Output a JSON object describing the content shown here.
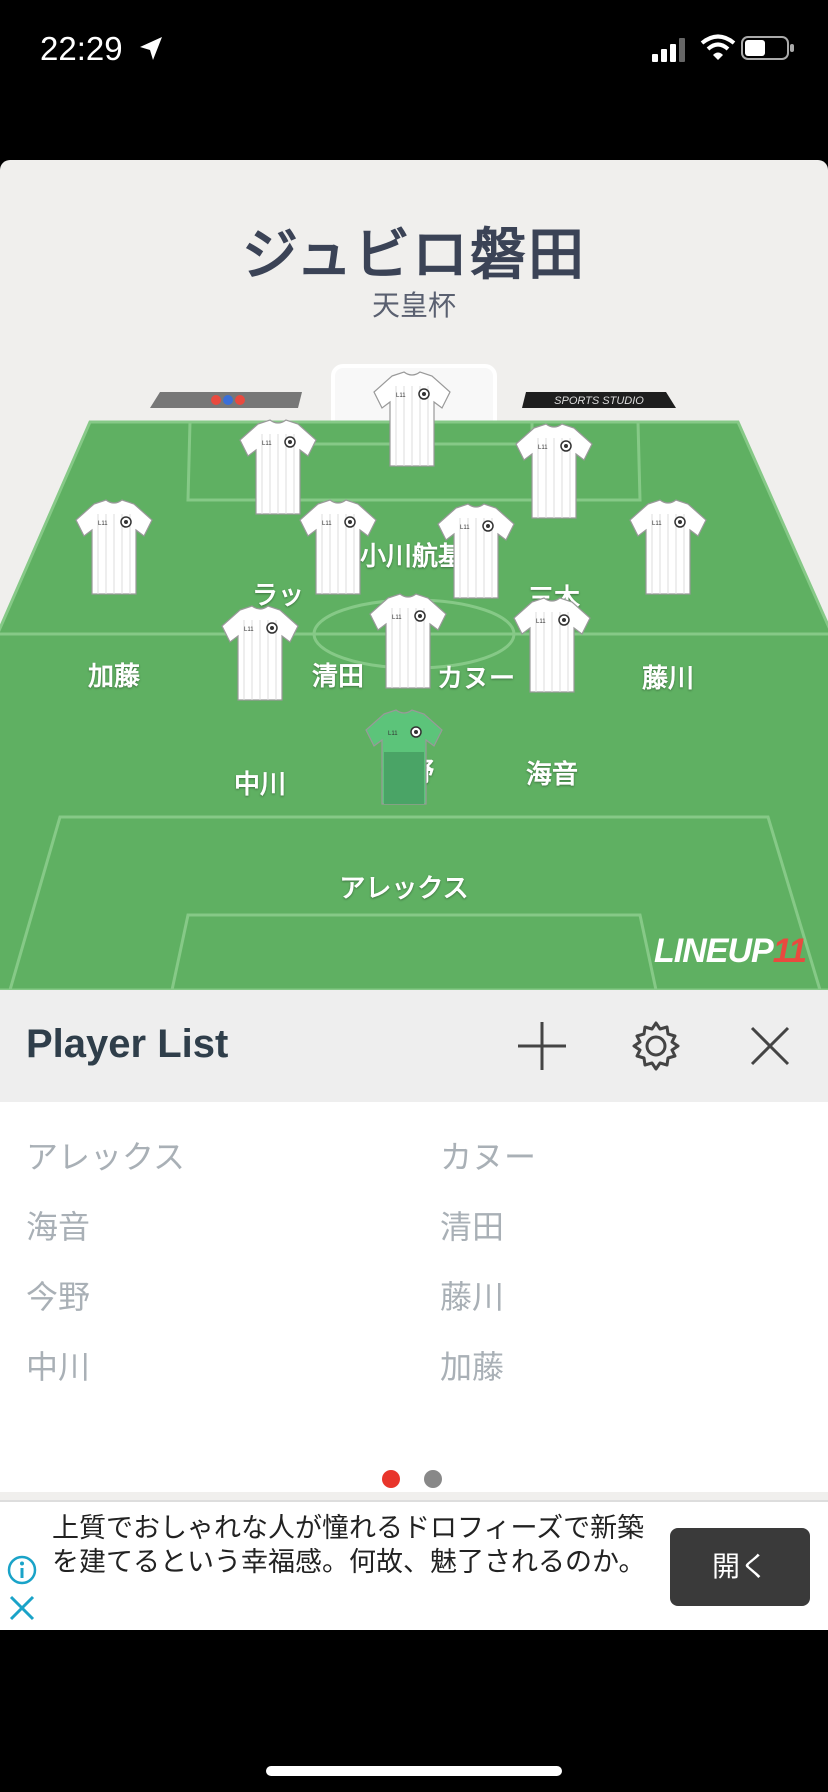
{
  "status": {
    "time": "22:29"
  },
  "team": {
    "name": "ジュビロ磐田",
    "competition": "天皇杯"
  },
  "players_on_field": [
    {
      "name": "小川航基",
      "role": "field"
    },
    {
      "name": "ラッ",
      "role": "field"
    },
    {
      "name": "三木",
      "role": "field"
    },
    {
      "name": "加藤",
      "role": "field"
    },
    {
      "name": "清田",
      "role": "field"
    },
    {
      "name": "カヌー",
      "role": "field"
    },
    {
      "name": "藤川",
      "role": "field"
    },
    {
      "name": "中川",
      "role": "field"
    },
    {
      "name": "今野",
      "role": "field"
    },
    {
      "name": "海音",
      "role": "field"
    },
    {
      "name": "アレックス",
      "role": "goalkeeper"
    }
  ],
  "board_text": {
    "right": "SPORTS STUDIO"
  },
  "brand": {
    "logo_text": "LINEUP",
    "logo_num": "11"
  },
  "player_list": {
    "title": "Player List",
    "left": [
      "アレックス",
      "海音",
      "今野",
      "中川"
    ],
    "right": [
      "カヌー",
      "清田",
      "藤川",
      "加藤"
    ]
  },
  "pager": {
    "active_color": "#e8352b",
    "inactive_color": "#888888"
  },
  "ad": {
    "text": "上質でおしゃれな人が憧れるドロフィーズで新築を建てるという幸福感。何故、魅了されるのか。",
    "button": "開く"
  },
  "colors": {
    "pitch": "#5fb062",
    "keeper_shirt": "#5cc47a"
  }
}
